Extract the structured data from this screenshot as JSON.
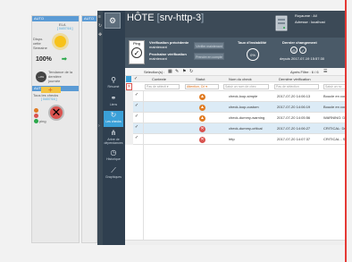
{
  "left_widgets": {
    "tab1": "AUTO",
    "tab2": "AUTO",
    "tab3": "AUTO",
    "ela_label": "ELA",
    "ela_time": "[ 04/07/16 ]",
    "period_text": "Dispo. cette Semaine",
    "dispo_pct": "100%",
    "tendance_badge": "+0%",
    "tendance_text": "Tendance de la dernière journée",
    "checks_text": "Tous les checks",
    "checks_time": "[ 04/07/16 ]",
    "ping_text": "ping"
  },
  "app": {
    "host_prefix": "HÔTE",
    "host_name": "srv-http-3",
    "royaume": "Royaume : All",
    "adresse": "Adresse : localhost",
    "status": {
      "ping_label": "Ping",
      "verif_prec_label": "Vérification précédente",
      "verif_prec_value": "maintenant",
      "verif_next_label": "Prochaine vérification",
      "verif_next_value": "maintenant",
      "btn_verify": "Vérifier maintenant",
      "btn_freshness": "Prendre en compte",
      "instab_label": "Taux d'instabilité",
      "instab_value": "0%",
      "last_change_label": "Dernier changement",
      "last_change_value": "depuis 2017-07-19 15:57:30"
    },
    "nav": [
      {
        "label": "Résumé",
        "icon": "search-icon"
      },
      {
        "label": "Liens",
        "icon": "network-icon"
      },
      {
        "label": "Les checks",
        "icon": "refresh-icon"
      },
      {
        "label": "Arbre de dépendances",
        "icon": "tree-icon"
      },
      {
        "label": "Historique",
        "icon": "clock-icon"
      },
      {
        "label": "Graphiques",
        "icon": "chart-icon"
      }
    ],
    "grid": {
      "selection_label": "Sélection(s) :",
      "filters_label": "Après Filtre : 6 / 6",
      "headers": [
        "Contexte",
        "Statut",
        "Nom du check",
        "Dernière vérification",
        ""
      ],
      "filter_placeholders": [
        "Pas de sélecti ▾",
        "Attention, Cri ▾",
        "Saisir un nom de chec",
        "Pas de sélection",
        "Saisir un no"
      ],
      "rows": [
        {
          "status": "warn",
          "name": "check-loop-simple",
          "date": "2017-07-20 14:06:13",
          "output": "Boucle en cou"
        },
        {
          "status": "warn",
          "name": "check-loop-custom",
          "date": "2017-07-20 14:06:19",
          "output": "Boucle en cou"
        },
        {
          "status": "warn",
          "name": "check-dummy-warning",
          "date": "2017-07-20 14:05:56",
          "output": "WARNING: Dum"
        },
        {
          "status": "crit",
          "name": "check-dummy-critical",
          "date": "2017-07-20 14:06:27",
          "output": "CRITICAL: Du"
        },
        {
          "status": "crit",
          "name": "http",
          "date": "2017-07-20 14:07:37",
          "output": "CRITICAL - So"
        }
      ]
    }
  }
}
